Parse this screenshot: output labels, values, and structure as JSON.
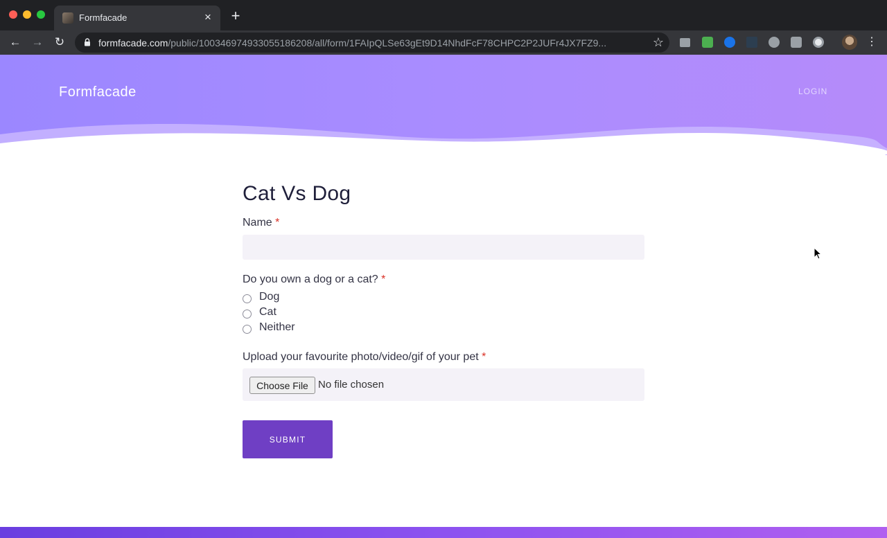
{
  "browser": {
    "tab_title": "Formfacade",
    "tab_close_icon": "close-icon",
    "new_tab_icon": "plus-icon",
    "url_host": "formfacade.com",
    "url_path": "/public/100346974933055186208/all/form/1FAIpQLSe63gEt9D14NhdFcF78CHPC2P2JUFr4JX7FZ9...",
    "extensions": [
      "google-drive-icon",
      "mail-check-icon",
      "compass-icon",
      "new-badge-icon",
      "u-circle-icon",
      "chat-icon",
      "record-icon"
    ]
  },
  "header": {
    "brand": "Formfacade",
    "login": "LOGIN",
    "gradient_colors": [
      "#9b87ff",
      "#b58bfa"
    ]
  },
  "form": {
    "title": "Cat Vs Dog",
    "required_marker": "*",
    "name_question": "Name",
    "name_value": "",
    "pet_question": "Do you own a dog or a cat?",
    "pet_options": [
      "Dog",
      "Cat",
      "Neither"
    ],
    "upload_question": "Upload your favourite photo/video/gif of your pet",
    "choose_file_label": "Choose File",
    "file_status": "No file chosen",
    "submit_label": "SUBMIT",
    "accent_color": "#6f3fc4"
  }
}
